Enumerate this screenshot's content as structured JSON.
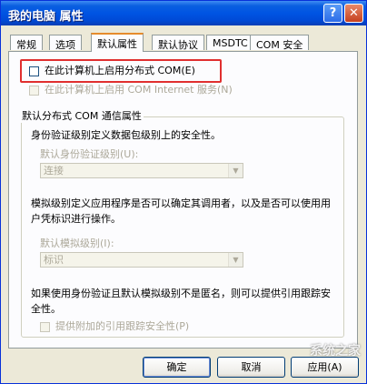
{
  "window": {
    "title": "我的电脑 属性",
    "help_btn": "?",
    "close_btn": "✕"
  },
  "tabs": [
    {
      "label": "常规"
    },
    {
      "label": "选项"
    },
    {
      "label": "默认属性"
    },
    {
      "label": "默认协议"
    },
    {
      "label": "MSDTC"
    },
    {
      "label": "COM 安全"
    }
  ],
  "active_tab": 2,
  "options": {
    "enable_dcom": "在此计算机上启用分布式 COM(E)",
    "enable_internet": "在此计算机上启用 COM Internet 服务(N)"
  },
  "group": {
    "title": "默认分布式 COM 通信属性",
    "auth_desc": "身份验证级别定义数据包级别上的安全性。",
    "auth_label": "默认身份验证级别(U):",
    "auth_value": "连接",
    "imp_desc": "模拟级别定义应用程序是否可以确定其调用者，以及是否可以使用用户凭标识进行操作。",
    "imp_label": "默认模拟级别(I):",
    "imp_value": "标识",
    "ref_desc": "如果使用身份验证且默认模拟级别不是匿名，则可以提供引用跟踪安全性。",
    "ref_check": "提供附加的引用跟踪安全性(P)"
  },
  "buttons": {
    "ok": "确定",
    "cancel": "取消",
    "apply": "应用(A)"
  },
  "watermark": "系统之家",
  "colors": {
    "title_bar": "#0054e3",
    "highlight": "#e02f2f",
    "dialog_bg": "#ece9d8"
  }
}
